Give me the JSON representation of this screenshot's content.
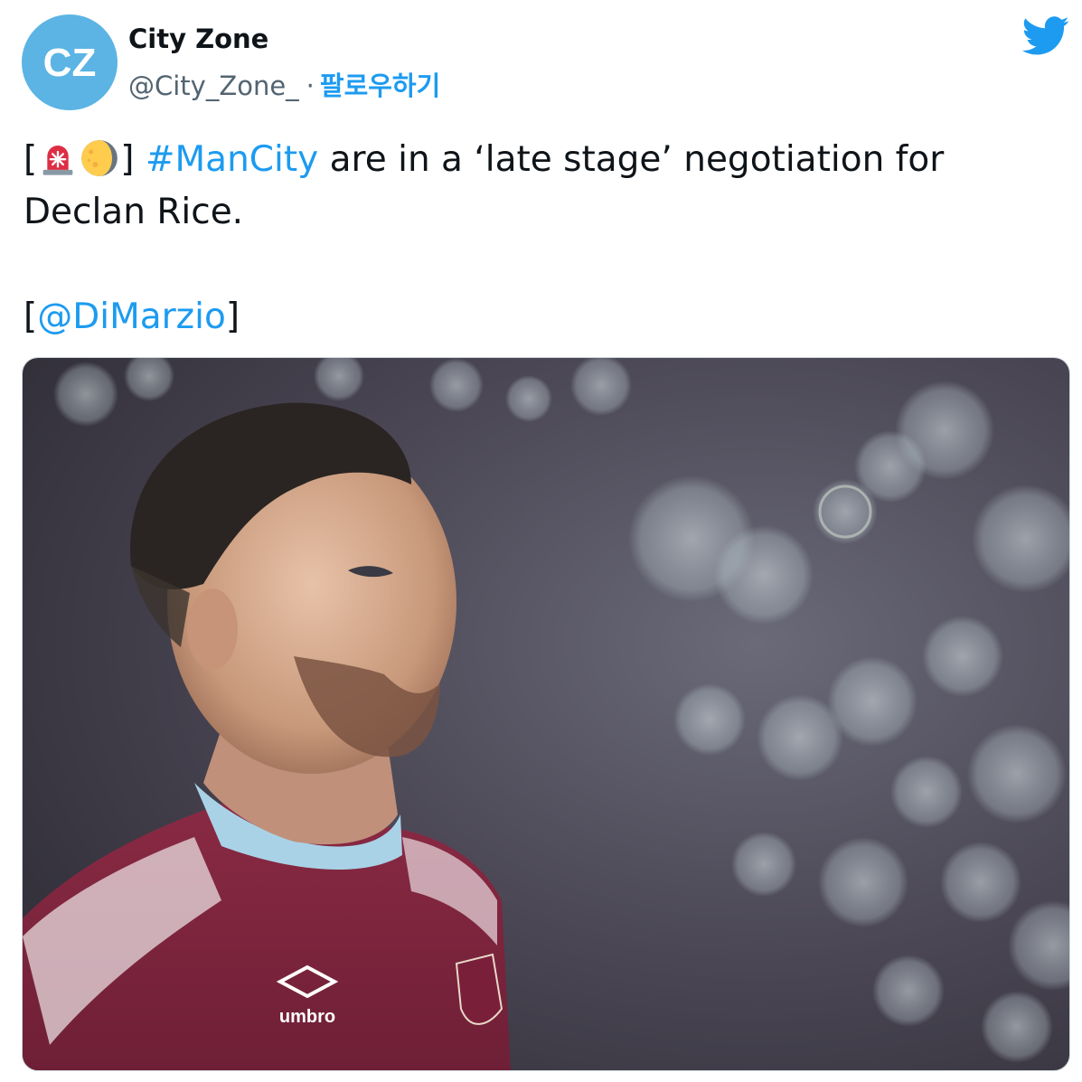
{
  "author": {
    "display_name": "City Zone",
    "handle": "@City_Zone_",
    "separator": "·",
    "follow_label": "팔로우하기",
    "avatar_text": "CZ",
    "avatar_color": "#5bb4e4"
  },
  "tweet": {
    "bracket_open": "[",
    "emojis": [
      "rotating-light-emoji",
      "waning-moon-emoji"
    ],
    "bracket_close": "]",
    "hashtag": "#ManCity",
    "text_line1_rest": "are in a ‘late stage’ negotiation for",
    "text_line2": "Declan Rice.",
    "mention_open": "[",
    "mention": "@DiMarzio",
    "mention_close": "]"
  },
  "media": {
    "jersey_sponsor": "umbro",
    "kind": "photo"
  },
  "colors": {
    "link": "#1d9bf0",
    "text": "#0f1419",
    "secondary": "#536471",
    "twitter_blue": "#1d9bf0"
  },
  "icons": {
    "brand": "twitter-bird-icon"
  }
}
